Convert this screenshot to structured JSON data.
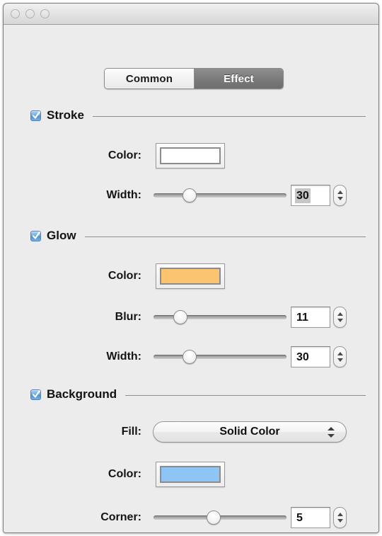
{
  "window": {
    "traffic_lights": [
      "close-button",
      "minimize-button",
      "zoom-button"
    ]
  },
  "tabs": {
    "common_label": "Common",
    "effect_label": "Effect",
    "selected": "Effect"
  },
  "sections": {
    "stroke": {
      "title": "Stroke",
      "checked": true,
      "color_label": "Color:",
      "color_value": "#ffffff",
      "width_label": "Width:",
      "width_value": "30",
      "width_slider_percent": 27
    },
    "glow": {
      "title": "Glow",
      "checked": true,
      "color_label": "Color:",
      "color_value": "#fbc470",
      "blur_label": "Blur:",
      "blur_value": "11",
      "blur_slider_percent": 20,
      "width_label": "Width:",
      "width_value": "30",
      "width_slider_percent": 27
    },
    "background": {
      "title": "Background",
      "checked": true,
      "fill_label": "Fill:",
      "fill_value": "Solid Color",
      "color_label": "Color:",
      "color_value": "#8ec5f5",
      "corner_label": "Corner:",
      "corner_value": "5",
      "corner_slider_percent": 45
    }
  }
}
